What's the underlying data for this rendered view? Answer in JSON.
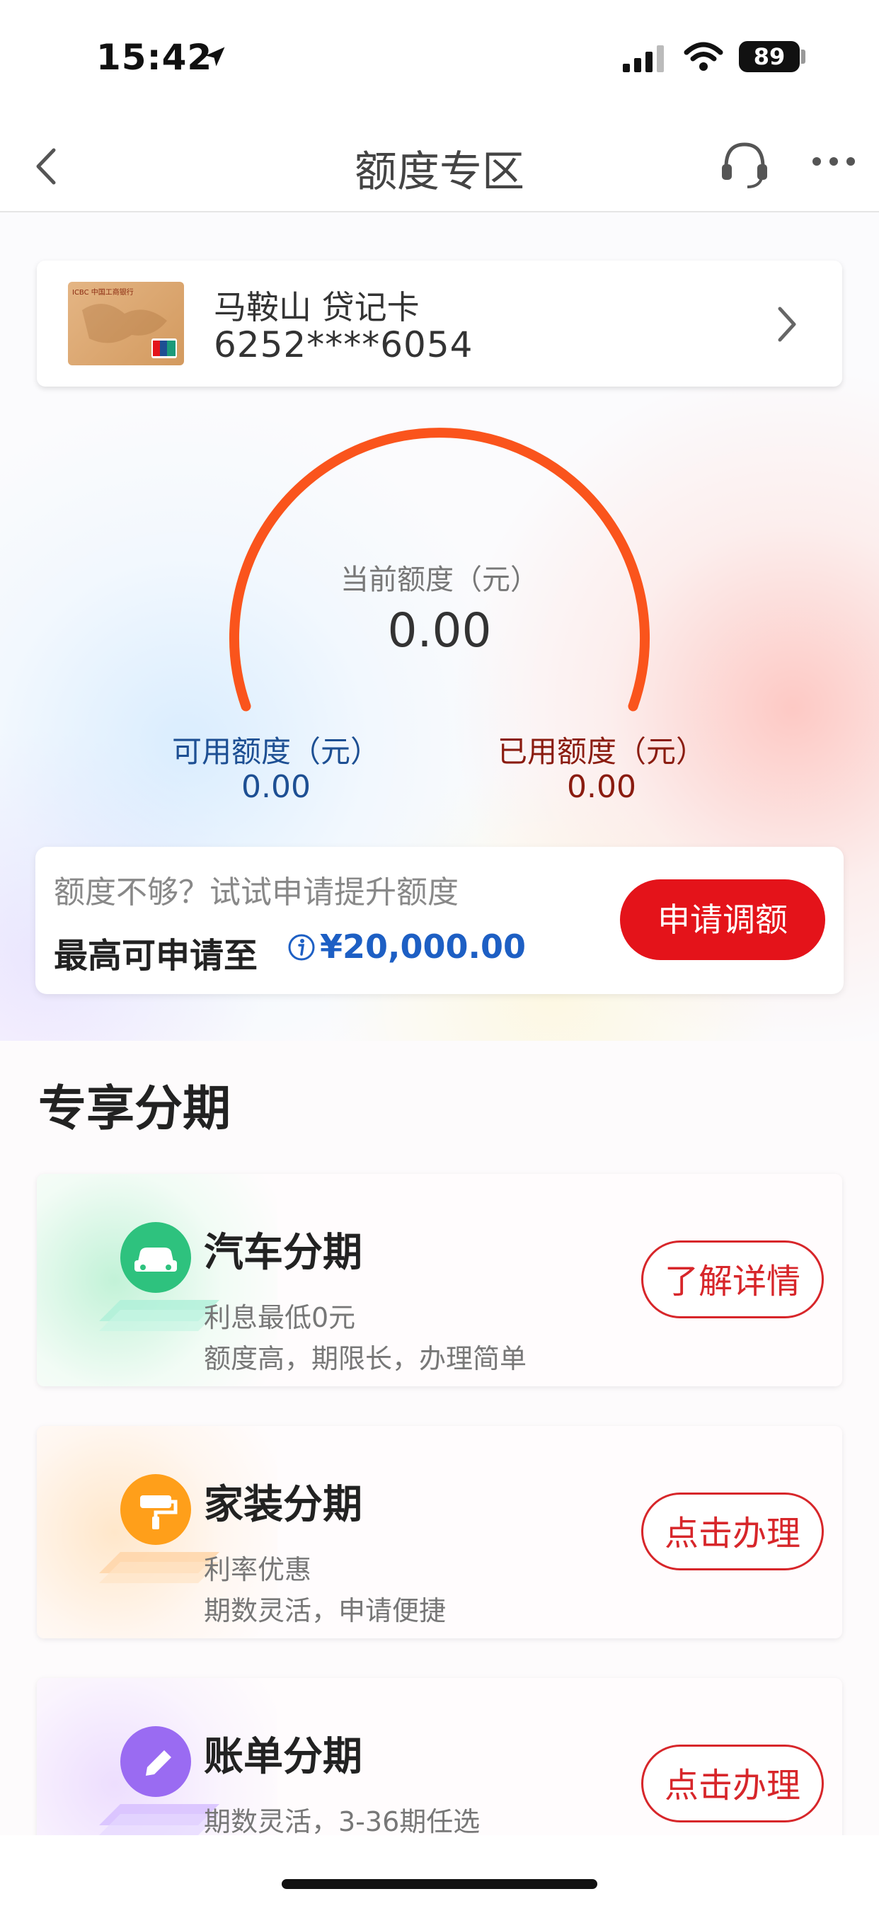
{
  "status_bar": {
    "time": "15:42",
    "battery": "89",
    "icons": [
      "location-arrow-icon",
      "cellular-signal-icon",
      "wifi-icon",
      "battery-icon"
    ]
  },
  "nav": {
    "title": "额度专区",
    "icons": [
      "back-chevron-icon",
      "customer-service-headset-icon",
      "more-dots-icon"
    ]
  },
  "card": {
    "name": "马鞍山 贷记卡",
    "number": "6252****6054",
    "thumb_text": "ICBC 中国工商银行"
  },
  "gauge": {
    "label": "当前额度（元）",
    "value": "0.00",
    "arc_color": "#fa541c",
    "available_label": "可用额度（元）",
    "available_value": "0.00",
    "used_label": "已用额度（元）",
    "used_value": "0.00"
  },
  "promo": {
    "text": "额度不够？试试申请提升额度",
    "max_label": "最高可申请至",
    "max_value": "¥20,000.00",
    "apply_button": "申请调额"
  },
  "section": {
    "title": "专享分期",
    "items": [
      {
        "title": "汽车分期",
        "line1": "利息最低0元",
        "line2": "额度高，期限长，办理简单",
        "button": "了解详情",
        "icon": "car-icon",
        "color": "#2ec27e"
      },
      {
        "title": "家装分期",
        "line1": "利率优惠",
        "line2": "期数灵活，申请便捷",
        "button": "点击办理",
        "icon": "paint-roller-icon",
        "color": "#ff9f1a"
      },
      {
        "title": "账单分期",
        "line1": "期数灵活，3-36期任选",
        "line2": "",
        "button": "点击办理",
        "icon": "pencil-icon",
        "color": "#9a6bf2"
      }
    ]
  },
  "colors": {
    "accent_red": "#e4131a",
    "blue": "#1d5fc4",
    "available_blue": "#1d4f93",
    "used_red": "#8a1c10"
  }
}
